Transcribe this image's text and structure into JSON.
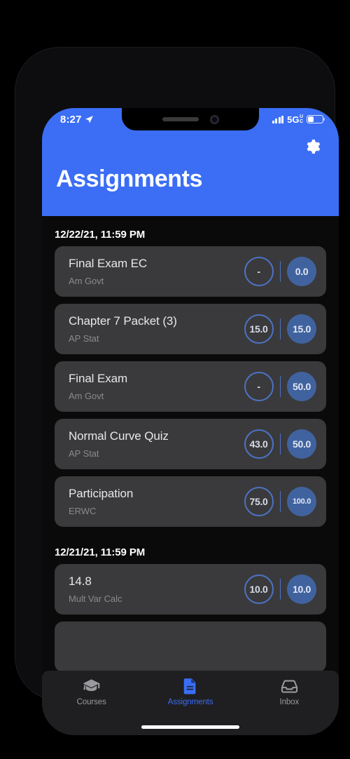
{
  "status_bar": {
    "time": "8:27",
    "location_icon": "location-arrow-icon",
    "signal_icon": "cellular-signal-icon",
    "network": "5G",
    "network_sub_top": "U",
    "network_sub_bottom": "C",
    "battery_icon": "battery-icon",
    "battery_level_percent": 38
  },
  "header": {
    "title": "Assignments",
    "settings_icon": "gear-icon",
    "background_color": "#3b6ef5"
  },
  "theme": {
    "accent": "#3b6ef5",
    "screen_bg": "#0a0a0a",
    "card_bg": "#3a3a3c",
    "score_outline": "#4d72c4",
    "score_fill": "#40639f",
    "muted_text": "#8a8a8e"
  },
  "sections": [
    {
      "date": "12/22/21, 11:59 PM",
      "assignments": [
        {
          "title": "Final Exam EC",
          "course": "Am Govt",
          "earned": "-",
          "total": "0.0"
        },
        {
          "title": "Chapter 7 Packet (3)",
          "course": "AP Stat",
          "earned": "15.0",
          "total": "15.0"
        },
        {
          "title": "Final Exam",
          "course": "Am Govt",
          "earned": "-",
          "total": "50.0"
        },
        {
          "title": "Normal Curve Quiz",
          "course": "AP Stat",
          "earned": "43.0",
          "total": "50.0"
        },
        {
          "title": "Participation",
          "course": "ERWC",
          "earned": "75.0",
          "total": "100.0"
        }
      ]
    },
    {
      "date": "12/21/21, 11:59 PM",
      "assignments": [
        {
          "title": "14.8",
          "course": "Mult Var Calc",
          "earned": "10.0",
          "total": "10.0"
        }
      ]
    }
  ],
  "tab_bar": {
    "items": [
      {
        "label": "Courses",
        "icon": "graduation-cap-icon",
        "active": false
      },
      {
        "label": "Assignments",
        "icon": "document-icon",
        "active": true
      },
      {
        "label": "Inbox",
        "icon": "inbox-tray-icon",
        "active": false
      }
    ]
  }
}
